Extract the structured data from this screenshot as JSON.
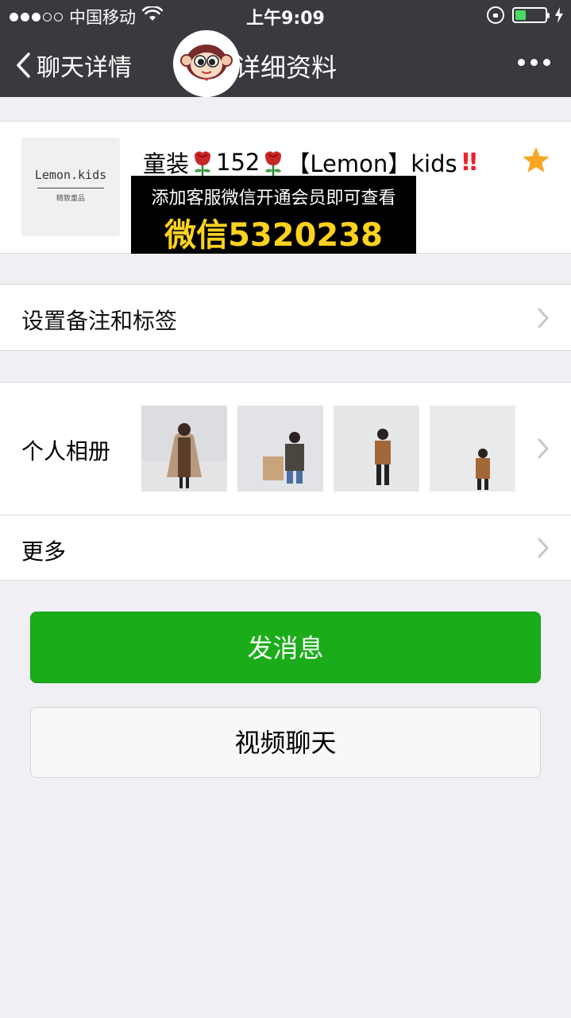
{
  "status": {
    "carrier": "中国移动",
    "time": "上午9:09",
    "signal_bars": 3,
    "signal_total": 5,
    "battery_level": 0.35
  },
  "nav": {
    "back_label": "聊天详情",
    "title_partial": "详细资料",
    "more_icon": "ellipsis-icon"
  },
  "profile": {
    "avatar_brand": "Lemon.kids",
    "avatar_sub": "精致童品",
    "name_part1": "童装",
    "name_part2": "152",
    "name_part3": "【Lemon】kids",
    "bangbang": "!!",
    "starred": true
  },
  "promo": {
    "line1": "添加客服微信开通会员即可查看",
    "line2": "微信5320238"
  },
  "rows": {
    "remark_label": "设置备注和标签",
    "album_label": "个人相册",
    "more_label": "更多"
  },
  "album": {
    "photos": [
      "photo-1",
      "photo-2",
      "photo-3",
      "photo-4"
    ]
  },
  "buttons": {
    "send_message": "发消息",
    "video_chat": "视频聊天"
  },
  "colors": {
    "nav_bg": "#393a3f",
    "primary_green": "#1aad19",
    "star": "#f7a623",
    "promo_text": "#ffd21f",
    "page_bg": "#efeff4"
  }
}
